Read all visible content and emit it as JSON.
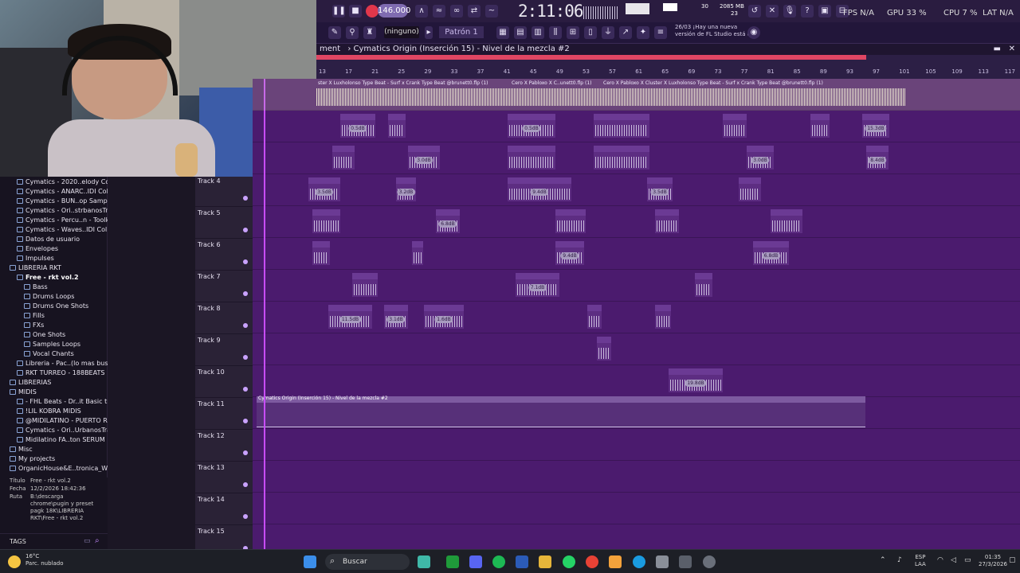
{
  "toolbar": {
    "tempo": "146.000",
    "clock": "2:11:06",
    "cpu_counter": "30",
    "memory": "2085 MB",
    "memory_sub": "23",
    "fps": "FPS N/A",
    "gpu": "GPU 33 %",
    "cpu": "CPU 7 %",
    "lat": "LAT N/A",
    "pattern": "Patrón 1",
    "ninguno": "(ninguno)",
    "hint": "26/03 ¡Hay una nueva versión de FL Studio está d..",
    "colors": {
      "accent": "#7f6bb0",
      "record": "#e0374b"
    }
  },
  "playlist": {
    "title_prefix": "ment",
    "title": "Cymatics Origin (Inserción 15) - Nivel de la mezcla #2",
    "ruler_numbers": [
      "13",
      "17",
      "21",
      "25",
      "29",
      "33",
      "37",
      "41",
      "45",
      "49",
      "53",
      "57",
      "61",
      "65",
      "69",
      "73",
      "77",
      "81",
      "85",
      "89",
      "93",
      "97",
      "101",
      "105",
      "109",
      "113",
      "117"
    ],
    "tracks": [
      "Track 4",
      "Track 5",
      "Track 6",
      "Track 7",
      "Track 8",
      "Track 9",
      "Track 10",
      "Track 11",
      "Track 12",
      "Track 13",
      "Track 14",
      "Track 15"
    ],
    "automation_clip": "Cymatics Origin (Inserción 15) - Nivel de la mezcla #2",
    "top_clip_a": "ster X Luxholonso Type Beat - Surf x Crank Type Beat @brunett0.flp (1)",
    "top_clip_b": "Cero X Pabloxo X C..unett0.flp (1)",
    "top_clip_c": "Cero X Pabloxo X Cluster X Luxholonso Type Beat - Surf x Crank Type Beat @brunett0.flp (1)",
    "clip_labels": [
      "GRA_45_MIC",
      "GRABA_6-50_MIC",
      "GRABA_4-20_MIC",
      "GRABA_6-50_MIC",
      "GRABA_4-20_MIC",
      "G_MIC",
      "GRABA_30_MIC",
      "GRABA_35-10_MIC",
      "GRA_59_MIC",
      "bien_MIC",
      "ble_3C",
      "Cyma"
    ],
    "db_labels": [
      "0.5dB",
      "1.0dB",
      "1.0dB",
      "13.0dB",
      "3.0dB",
      "6.0dB",
      "3.0dB",
      "8.4dB",
      "3.5dB",
      "3.2dB",
      "9.4dB",
      "15.3dB",
      "3.5dB",
      "6.8dB",
      "3.0dB",
      "3.0dB",
      "9.4dB",
      "6.8dB",
      "7.1dB",
      "11.5dB",
      "3.1dB",
      "1.6dB",
      "19.8dB"
    ]
  },
  "browser": {
    "items": [
      {
        "label": "Cymatics - 2020..elody Collection",
        "level": 1
      },
      {
        "label": "Cymatics - ANARC..IDI Collection",
        "level": 1
      },
      {
        "label": "Cymatics - BUN..op Sample Pack",
        "level": 1
      },
      {
        "label": "Cymatics - Ori..strbanosTrapReg",
        "level": 1
      },
      {
        "label": "Cymatics - Percu..n - Toolkit Vol 1",
        "level": 1
      },
      {
        "label": "Cymatics - Waves..IDI Collection",
        "level": 1
      },
      {
        "label": "Datos de usuario",
        "level": 1
      },
      {
        "label": "Envelopes",
        "level": 1
      },
      {
        "label": "Impulses",
        "level": 1
      },
      {
        "label": "LIBRERIA RKT",
        "level": 0
      },
      {
        "label": "Free - rkt vol.2",
        "level": 1
      },
      {
        "label": "Bass",
        "level": 2
      },
      {
        "label": "Drums Loops",
        "level": 2
      },
      {
        "label": "Drums One Shots",
        "level": 2
      },
      {
        "label": "Fills",
        "level": 2
      },
      {
        "label": "FXs",
        "level": 2
      },
      {
        "label": "One Shots",
        "level": 2
      },
      {
        "label": "Samples Loops",
        "level": 2
      },
      {
        "label": "Vocal Chants",
        "level": 2
      },
      {
        "label": "Libreria - Pac..(lo mas buscado)",
        "level": 1
      },
      {
        "label": "RKT  TURREO - 188BEATS",
        "level": 1
      },
      {
        "label": "LIBRERIAS",
        "level": 0
      },
      {
        "label": "MIDIS",
        "level": 0
      },
      {
        "label": "- FHL Beats - Dr..it Basic trapity",
        "level": 1
      },
      {
        "label": "!LIL KOBRA MIDIS",
        "level": 1
      },
      {
        "label": "@MIDILATINO - PUERTO RICO",
        "level": 1
      },
      {
        "label": "Cymatics - Ori..UrbanosTrapReg",
        "level": 1
      },
      {
        "label": "Midilatino FA..ton SERUM Bank",
        "level": 1
      },
      {
        "label": "Misc",
        "level": 0
      },
      {
        "label": "My projects",
        "level": 0
      },
      {
        "label": "OrganicHouse&E..tronica_Wav_SP",
        "level": 0
      }
    ],
    "info": {
      "titulo_label": "Título",
      "titulo": "Free - rkt vol.2",
      "fecha_label": "Fecha",
      "fecha": "12/2/2026 18:42:36",
      "ruta_label": "Ruta",
      "ruta": "B:\\descarga chrome\\pugin y preset pagk 18K\\LIBRERIA RKT\\Free - rkt vol.2"
    },
    "tags": "TAGS"
  },
  "taskbar": {
    "weather_temp": "16°C",
    "weather_desc": "Parc. nublado",
    "search": "Buscar",
    "lang_top": "ESP",
    "lang_bottom": "LAA",
    "time": "01:35",
    "date": "27/3/2026"
  }
}
